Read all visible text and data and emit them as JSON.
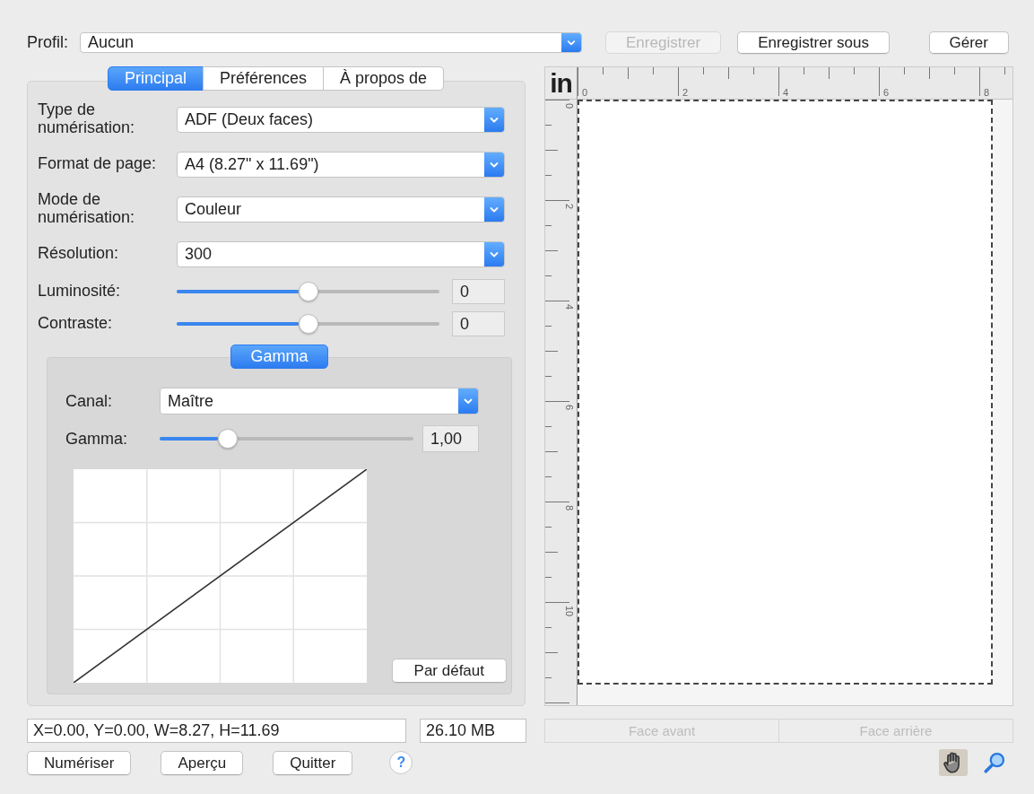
{
  "profile": {
    "label": "Profil:",
    "value": "Aucun"
  },
  "top_buttons": [
    {
      "label": "Enregistrer",
      "disabled": true
    },
    {
      "label": "Enregistrer sous",
      "disabled": false
    },
    {
      "label": "Gérer",
      "disabled": false
    }
  ],
  "tabs": [
    {
      "label": "Principal",
      "selected": true
    },
    {
      "label": "Préférences",
      "selected": false
    },
    {
      "label": "À propos de",
      "selected": false
    }
  ],
  "settings": [
    {
      "kind": "dropdown",
      "label": "Type de numérisation:",
      "value": "ADF (Deux faces)"
    },
    {
      "kind": "dropdown",
      "label": "Format de page:",
      "value": "A4 (8.27\" x 11.69\")"
    },
    {
      "kind": "dropdown",
      "label": "Mode de numérisation:",
      "value": "Couleur"
    },
    {
      "kind": "dropdown",
      "label": "Résolution:",
      "value": "300"
    },
    {
      "kind": "slider",
      "label": "Luminosité:",
      "level": 0.5,
      "value": "0"
    },
    {
      "kind": "slider",
      "label": "Contraste:",
      "level": 0.5,
      "value": "0"
    }
  ],
  "gamma_panel": {
    "tab": {
      "label": "Gamma",
      "selected": true
    },
    "channel": {
      "label": "Canal:",
      "value": "Maître"
    },
    "gamma": {
      "label": "Gamma:",
      "level": 0.27,
      "value": "1,00"
    },
    "default_button": {
      "label": "Par défaut"
    }
  },
  "preview": {
    "unit": "in",
    "x_labels": [
      "0",
      "2",
      "4",
      "6",
      "8"
    ],
    "y_labels": [
      "0",
      "2",
      "4",
      "6",
      "8",
      "10"
    ]
  },
  "status": {
    "selection": "X=0.00, Y=0.00, W=8.27, H=11.69",
    "size": "26.10 MB"
  },
  "side_buttons": [
    {
      "label": "Face avant",
      "disabled": true
    },
    {
      "label": "Face arrière",
      "disabled": true
    }
  ],
  "bottom_buttons": [
    {
      "label": "Numériser"
    },
    {
      "label": "Aperçu"
    },
    {
      "label": "Quitter"
    }
  ],
  "help": {
    "label": "?"
  },
  "tools": [
    {
      "kind": "hand",
      "selected": true
    },
    {
      "kind": "magnifier",
      "selected": false
    }
  ]
}
